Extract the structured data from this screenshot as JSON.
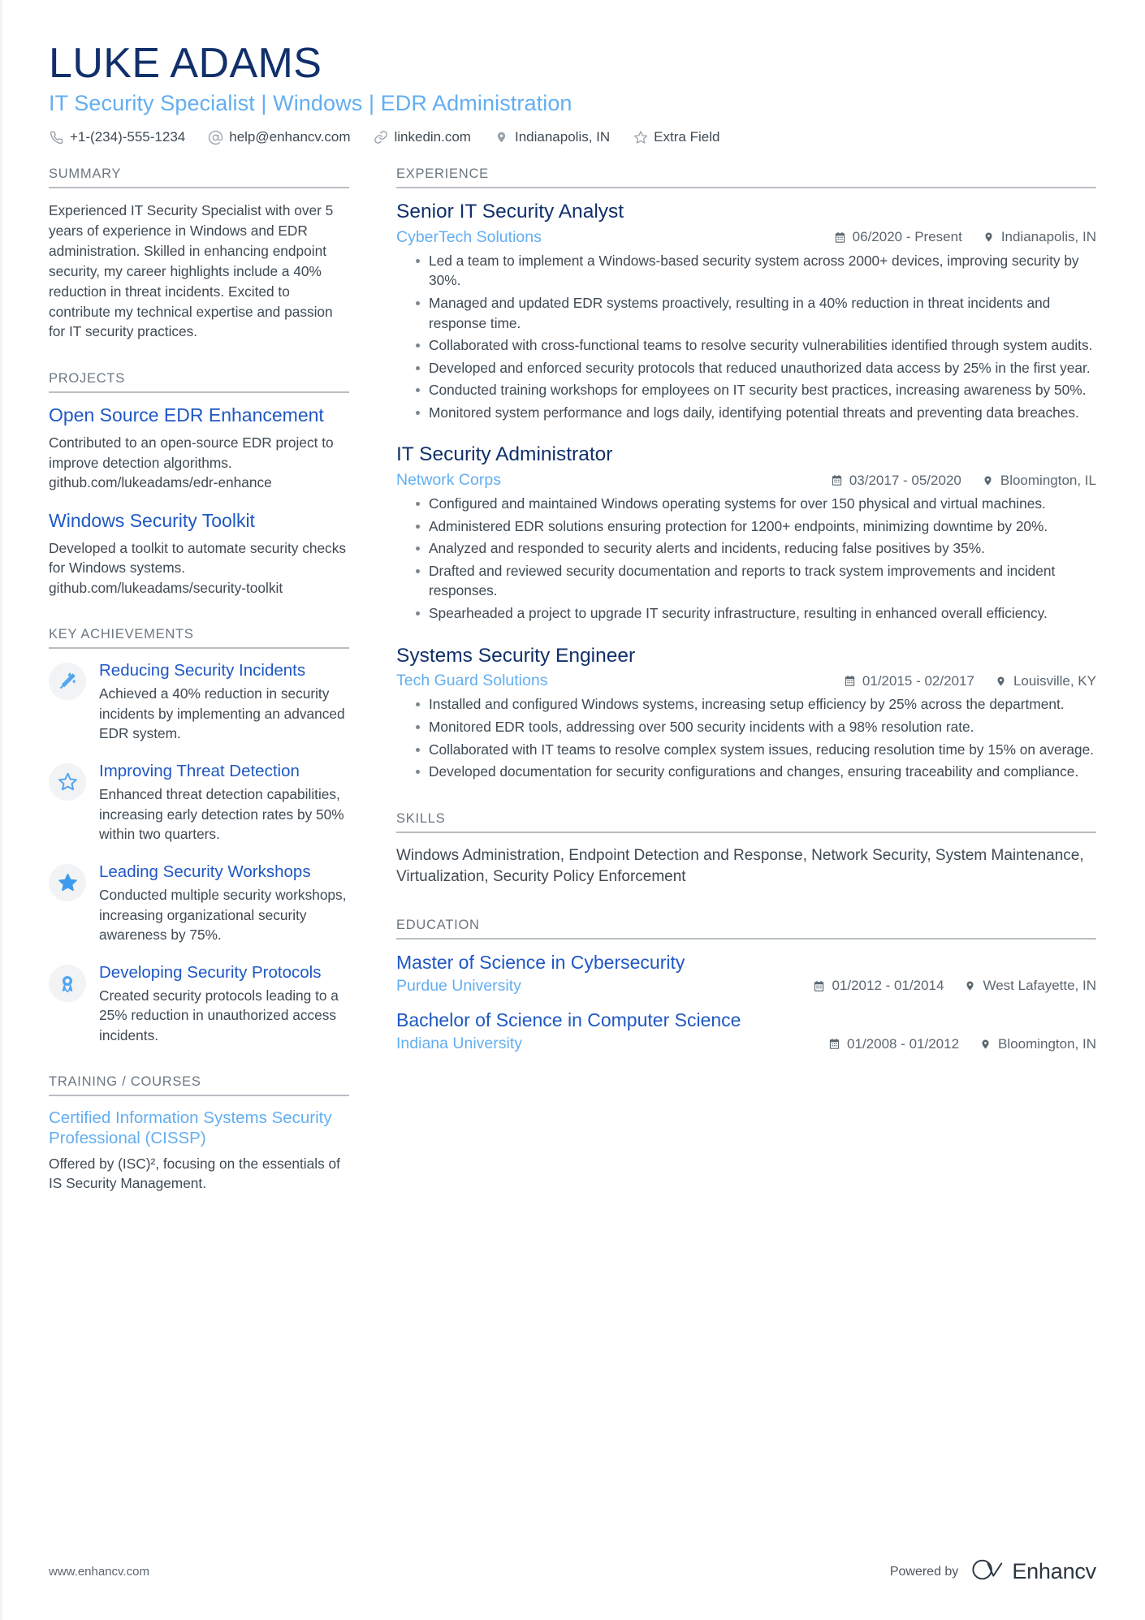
{
  "header": {
    "name": "LUKE ADAMS",
    "headline": "IT Security Specialist | Windows | EDR Administration",
    "contacts": [
      {
        "icon": "phone-icon",
        "text": "+1-(234)-555-1234"
      },
      {
        "icon": "email-icon",
        "text": "help@enhancv.com"
      },
      {
        "icon": "link-icon",
        "text": "linkedin.com"
      },
      {
        "icon": "location-icon",
        "text": "Indianapolis, IN"
      },
      {
        "icon": "star-icon",
        "text": "Extra Field"
      }
    ]
  },
  "left": {
    "summary": {
      "title": "SUMMARY",
      "text": "Experienced IT Security Specialist with over 5 years of experience in Windows and EDR administration. Skilled in enhancing endpoint security, my career highlights include a 40% reduction in threat incidents. Excited to contribute my technical expertise and passion for IT security practices."
    },
    "projects": {
      "title": "PROJECTS",
      "items": [
        {
          "name": "Open Source EDR Enhancement",
          "description": "Contributed to an open-source EDR project to improve detection algorithms. github.com/lukeadams/edr-enhance"
        },
        {
          "name": "Windows Security Toolkit",
          "description": "Developed a toolkit to automate security checks for Windows systems. github.com/lukeadams/security-toolkit"
        }
      ]
    },
    "achievements": {
      "title": "KEY ACHIEVEMENTS",
      "items": [
        {
          "icon": "magic-wand-icon",
          "name": "Reducing Security Incidents",
          "description": "Achieved a 40% reduction in security incidents by implementing an advanced EDR system."
        },
        {
          "icon": "star-outline-icon",
          "name": "Improving Threat Detection",
          "description": "Enhanced threat detection capabilities, increasing early detection rates by 50% within two quarters."
        },
        {
          "icon": "star-filled-icon",
          "name": "Leading Security Workshops",
          "description": "Conducted multiple security workshops, increasing organizational security awareness by 75%."
        },
        {
          "icon": "award-ribbon-icon",
          "name": "Developing Security Protocols",
          "description": "Created security protocols leading to a 25% reduction in unauthorized access incidents."
        }
      ]
    },
    "training": {
      "title": "TRAINING / COURSES",
      "items": [
        {
          "name": "Certified Information Systems Security Professional (CISSP)",
          "description": "Offered by (ISC)², focusing on the essentials of IS Security Management."
        }
      ]
    }
  },
  "right": {
    "experience": {
      "title": "EXPERIENCE",
      "items": [
        {
          "role": "Senior IT Security Analyst",
          "company": "CyberTech Solutions",
          "date": "06/2020 - Present",
          "location": "Indianapolis, IN",
          "bullets": [
            "Led a team to implement a Windows-based security system across 2000+ devices, improving security by 30%.",
            "Managed and updated EDR systems proactively, resulting in a 40% reduction in threat incidents and response time.",
            "Collaborated with cross-functional teams to resolve security vulnerabilities identified through system audits.",
            "Developed and enforced security protocols that reduced unauthorized data access by 25% in the first year.",
            "Conducted training workshops for employees on IT security best practices, increasing awareness by 50%.",
            "Monitored system performance and logs daily, identifying potential threats and preventing data breaches."
          ]
        },
        {
          "role": "IT Security Administrator",
          "company": "Network Corps",
          "date": "03/2017 - 05/2020",
          "location": "Bloomington, IL",
          "bullets": [
            "Configured and maintained Windows operating systems for over 150 physical and virtual machines.",
            "Administered EDR solutions ensuring protection for 1200+ endpoints, minimizing downtime by 20%.",
            "Analyzed and responded to security alerts and incidents, reducing false positives by 35%.",
            "Drafted and reviewed security documentation and reports to track system improvements and incident responses.",
            "Spearheaded a project to upgrade IT security infrastructure, resulting in enhanced overall efficiency."
          ]
        },
        {
          "role": "Systems Security Engineer",
          "company": "Tech Guard Solutions",
          "date": "01/2015 - 02/2017",
          "location": "Louisville, KY",
          "bullets": [
            "Installed and configured Windows systems, increasing setup efficiency by 25% across the department.",
            "Monitored EDR tools, addressing over 500 security incidents with a 98% resolution rate.",
            "Collaborated with IT teams to resolve complex system issues, reducing resolution time by 15% on average.",
            "Developed documentation for security configurations and changes, ensuring traceability and compliance."
          ]
        }
      ]
    },
    "skills": {
      "title": "SKILLS",
      "text": "Windows Administration, Endpoint Detection and Response, Network Security, System Maintenance, Virtualization, Security Policy Enforcement"
    },
    "education": {
      "title": "EDUCATION",
      "items": [
        {
          "degree": "Master of Science in Cybersecurity",
          "school": "Purdue University",
          "date": "01/2012 - 01/2014",
          "location": "West Lafayette, IN"
        },
        {
          "degree": "Bachelor of Science in Computer Science",
          "school": "Indiana University",
          "date": "01/2008 - 01/2012",
          "location": "Bloomington, IN"
        }
      ]
    }
  },
  "footer": {
    "url": "www.enhancv.com",
    "powered_by": "Powered by",
    "brand": "Enhancv"
  },
  "colors": {
    "name_navy": "#11306b",
    "headline_blue": "#63aef0",
    "link_blue": "#1f58c4",
    "body_gray": "#3f4a52",
    "section_gray": "#6b7780",
    "rule_gray": "#b9bec3",
    "badge_bg": "#f2f3f4"
  }
}
